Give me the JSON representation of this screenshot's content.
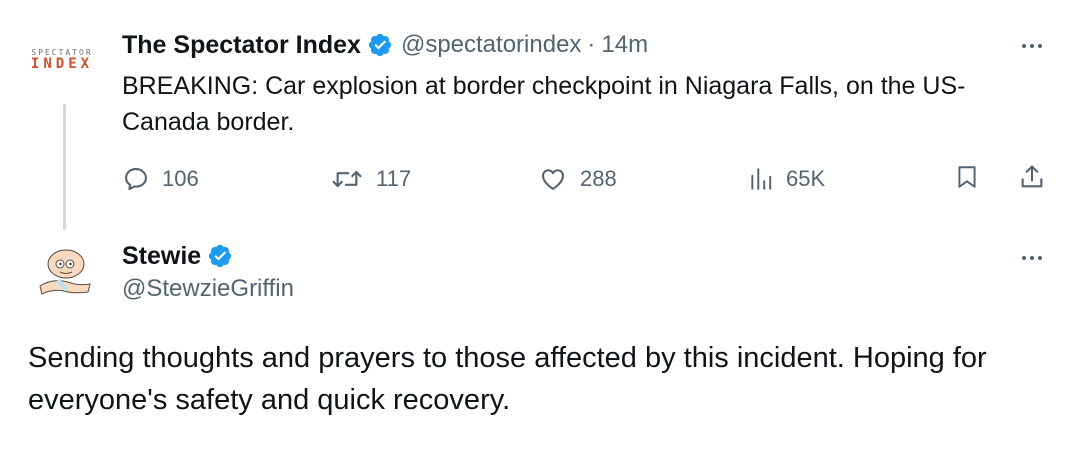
{
  "tweet1": {
    "logo_top": "SPECTATOR",
    "logo_bottom": "INDEX",
    "name": "The Spectator Index",
    "handle": "@spectatorindex",
    "separator": "·",
    "time": "14m",
    "text": "BREAKING: Car explosion at border checkpoint in Niagara Falls, on the US-Canada border.",
    "replies": "106",
    "reposts": "117",
    "likes": "288",
    "views": "65K"
  },
  "tweet2": {
    "name": "Stewie",
    "handle": "@StewzieGriffin",
    "text": "Sending thoughts and prayers to those affected by this incident. Hoping for everyone's safety and quick recovery."
  },
  "icons": {
    "verified": "verified-badge-icon",
    "reply": "reply-icon",
    "repost": "repost-icon",
    "like": "heart-icon",
    "views": "views-chart-icon",
    "bookmark": "bookmark-icon",
    "share": "share-icon",
    "more": "more-icon"
  },
  "colors": {
    "text": "#0f1419",
    "secondary": "#536471",
    "verified": "#1d9bf0",
    "thread_line": "#cfd9de",
    "logo_accent": "#c9512c"
  }
}
